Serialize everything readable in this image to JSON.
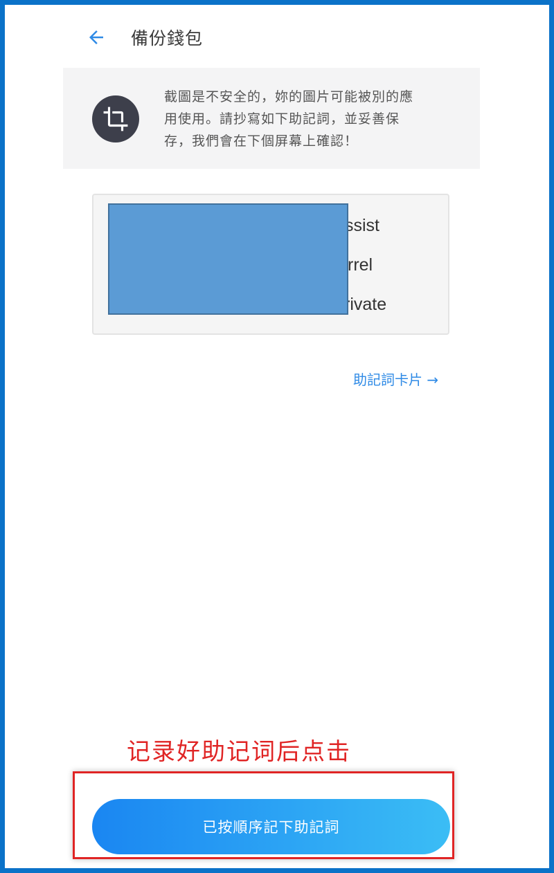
{
  "header": {
    "back_icon": "arrow-left-icon",
    "title": "備份錢包"
  },
  "warning": {
    "icon": "crop-icon",
    "text_lines": [
      "截圖是不安全的，妳的圖片可能被別的應",
      "用使用。請抄寫如下助記詞，並妥善保",
      "存，我們會在下個屏幕上確認！"
    ]
  },
  "mnemonic": {
    "visible_words": [
      "ssist",
      "rrel",
      "rivate"
    ]
  },
  "card_link": {
    "label": "助記詞卡片 →"
  },
  "annotation": {
    "text": "记录好助记词后点击"
  },
  "confirm_button": {
    "label": "已按順序記下助記詞"
  },
  "colors": {
    "frame": "#0b72c8",
    "accent": "#1a86f2",
    "annotation": "#e02424",
    "redaction": "#5b9bd5"
  }
}
